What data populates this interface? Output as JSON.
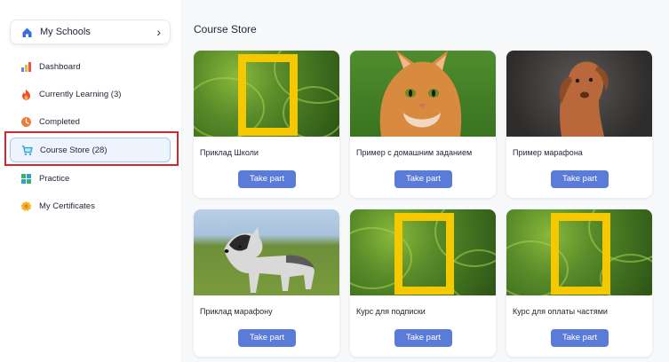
{
  "sidebar": {
    "school_select": {
      "label": "My Schools"
    },
    "items": [
      {
        "label": "Dashboard",
        "icon": "chart-icon"
      },
      {
        "label": "Currently Learning (3)",
        "icon": "flame-icon"
      },
      {
        "label": "Completed",
        "icon": "clock-icon"
      },
      {
        "label": "Course Store (28)",
        "icon": "cart-icon",
        "active": true
      },
      {
        "label": "Practice",
        "icon": "grid-icon"
      },
      {
        "label": "My Certificates",
        "icon": "badge-icon"
      }
    ]
  },
  "main": {
    "title": "Course Store",
    "cards": [
      {
        "title": "Приклад Школи",
        "button": "Take part",
        "image": "green-frame"
      },
      {
        "title": "Пример с домашним заданием",
        "button": "Take part",
        "image": "cat"
      },
      {
        "title": "Пример марафона",
        "button": "Take part",
        "image": "dog"
      },
      {
        "title": "Приклад марафону",
        "button": "Take part",
        "image": "husky-puppy"
      },
      {
        "title": "Курс для подписки",
        "button": "Take part",
        "image": "green-frame"
      },
      {
        "title": "Курс для оплаты частями",
        "button": "Take part",
        "image": "green-frame"
      }
    ]
  },
  "colors": {
    "accent": "#5b7bd9",
    "highlight": "#d7262a",
    "active_bg": "#eef4fd"
  }
}
